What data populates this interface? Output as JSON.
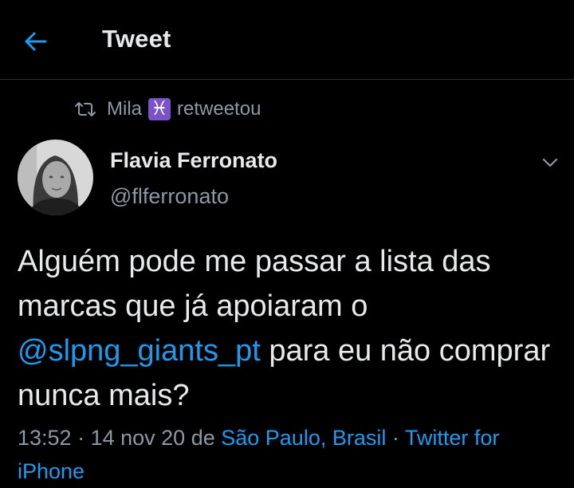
{
  "header": {
    "title": "Tweet",
    "back_icon": "arrow-left-icon",
    "accent_color": "#1d9bf0"
  },
  "retweet": {
    "icon": "retweet-icon",
    "user": "Mila",
    "emoji": "♓",
    "action": "retweetou"
  },
  "tweet": {
    "author_name": "Flavia Ferronato",
    "author_handle": "@flferronato",
    "more_icon": "chevron-down-icon",
    "text_before": "Alguém pode me passar a lista das marcas que já apoiaram o ",
    "mention": "@slpng_giants_pt",
    "text_after": " para eu não comprar nunca mais?",
    "time": "13:52",
    "sep1": " · ",
    "date": "14 nov 20",
    "de": " de ",
    "location": "São Paulo, Brasil",
    "sep2": " · ",
    "source": "Twitter for iPhone"
  }
}
